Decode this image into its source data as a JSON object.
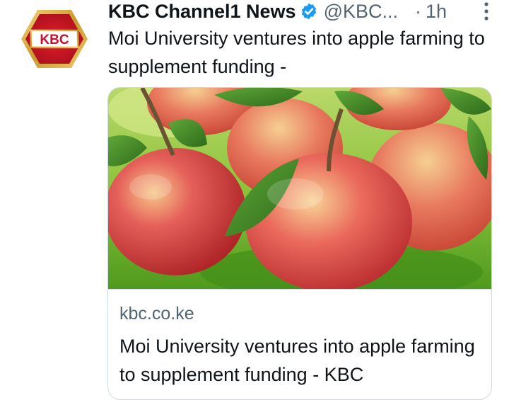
{
  "author": {
    "name": "KBC Channel1 News",
    "handle": "@KBC...",
    "separator": "·",
    "time": "1h",
    "avatar_text": "KBC",
    "verified": true
  },
  "tweet": {
    "text": "Moi University ventures into apple farming to supplement funding -"
  },
  "card": {
    "image_icon": "apples-photo",
    "domain": "kbc.co.ke",
    "title": "Moi University ventures into apple farming to supplement funding - KBC"
  },
  "colors": {
    "verified": "#1d9bf0",
    "secondary_text": "#536471",
    "border": "#cfd9de",
    "kbc_red": "#c8102e",
    "kbc_gold": "#d4a017"
  }
}
